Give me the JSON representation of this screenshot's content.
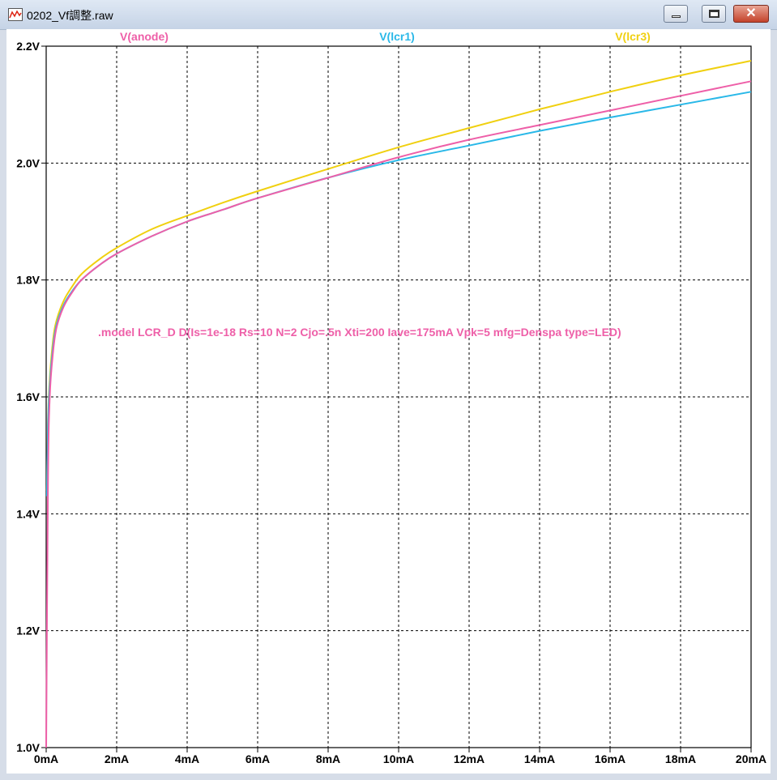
{
  "window": {
    "title": "0202_Vf調整.raw",
    "controls": {
      "minimize": "minimize",
      "maximize": "maximize",
      "close": "✕"
    }
  },
  "colors": {
    "anode": "#ee5fa8",
    "lcr1": "#29b8e8",
    "lcr3": "#f0d010",
    "grid": "#000000"
  },
  "chart_data": {
    "type": "line",
    "xlabel": "",
    "ylabel": "",
    "xlim": [
      0,
      20
    ],
    "ylim": [
      1.0,
      2.2
    ],
    "x_ticks": [
      "0mA",
      "2mA",
      "4mA",
      "6mA",
      "8mA",
      "10mA",
      "12mA",
      "14mA",
      "16mA",
      "18mA",
      "20mA"
    ],
    "y_ticks": [
      "1.0V",
      "1.2V",
      "1.4V",
      "1.6V",
      "1.8V",
      "2.0V",
      "2.2V"
    ],
    "grid": true,
    "annotation": ".model LCR_D D(Is=1e-18 Rs=10 N=2 Cjo=.5n Xti=200 Iave=175mA Vpk=5 mfg=Denspa type=LED)",
    "series": [
      {
        "name": "V(anode)",
        "color": "#ee5fa8",
        "x": [
          0,
          0.05,
          0.1,
          0.2,
          0.3,
          0.5,
          0.75,
          1,
          1.5,
          2,
          3,
          4,
          5,
          6,
          8,
          10,
          12,
          14,
          16,
          18,
          20
        ],
        "y": [
          1.0,
          1.45,
          1.6,
          1.68,
          1.72,
          1.755,
          1.78,
          1.8,
          1.825,
          1.845,
          1.875,
          1.9,
          1.92,
          1.94,
          1.975,
          2.01,
          2.04,
          2.065,
          2.09,
          2.115,
          2.14
        ]
      },
      {
        "name": "V(lcr1)",
        "color": "#29b8e8",
        "x": [
          0.02,
          0.05,
          0.1,
          0.2,
          0.3,
          0.5,
          0.75,
          1,
          1.5,
          2,
          3,
          4,
          5,
          6,
          8,
          10,
          12,
          14,
          16,
          18,
          20
        ],
        "y": [
          1.43,
          1.55,
          1.62,
          1.69,
          1.725,
          1.758,
          1.782,
          1.8,
          1.825,
          1.845,
          1.875,
          1.9,
          1.92,
          1.94,
          1.975,
          2.005,
          2.03,
          2.055,
          2.078,
          2.1,
          2.122
        ]
      },
      {
        "name": "V(lcr3)",
        "color": "#f0d010",
        "x": [
          0.02,
          0.05,
          0.1,
          0.2,
          0.3,
          0.5,
          0.75,
          1,
          1.5,
          2,
          3,
          4,
          5,
          6,
          8,
          10,
          12,
          14,
          16,
          18,
          20
        ],
        "y": [
          1.44,
          1.56,
          1.63,
          1.7,
          1.732,
          1.765,
          1.79,
          1.81,
          1.835,
          1.855,
          1.887,
          1.91,
          1.932,
          1.952,
          1.99,
          2.027,
          2.06,
          2.092,
          2.122,
          2.15,
          2.175
        ]
      }
    ]
  }
}
